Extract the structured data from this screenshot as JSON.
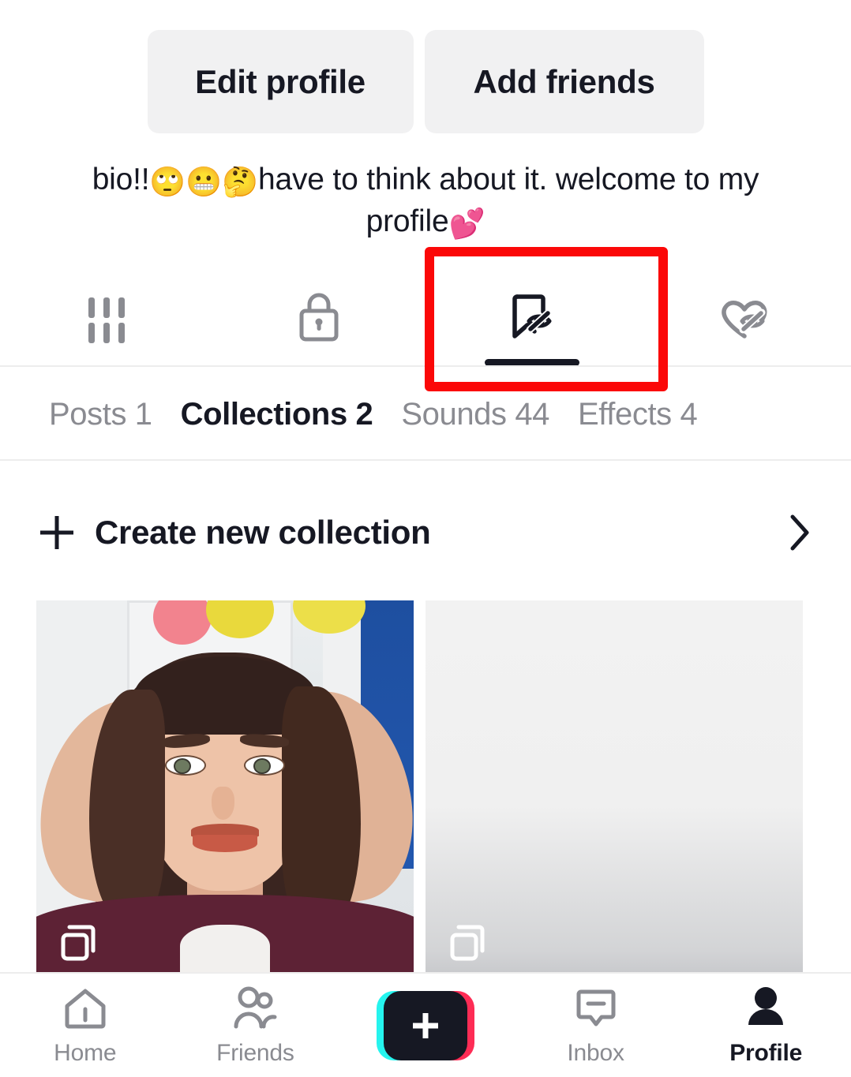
{
  "profile_actions": {
    "edit_profile_label": "Edit profile",
    "add_friends_label": "Add friends"
  },
  "bio": {
    "line1_before": "bio!!",
    "emoji1": "🙄",
    "emoji2": "😬",
    "emoji3": "🤔",
    "line1_after": "have to think about it.",
    "line2_text": "welcome to my profile",
    "emoji4": "💕",
    "full_text": "bio!!🙄😬🤔have to think about it. welcome to my profile💕"
  },
  "icon_tabs": [
    {
      "name": "posts-grid",
      "icon": "grid-bars-icon",
      "active": false
    },
    {
      "name": "private-posts",
      "icon": "lock-icon",
      "active": false
    },
    {
      "name": "saved-collections",
      "icon": "bookmark-eye-slash-icon",
      "active": true
    },
    {
      "name": "liked-videos",
      "icon": "heart-eye-slash-icon",
      "active": false
    }
  ],
  "highlight": {
    "color": "#fb0808",
    "target": "saved-collections-tab"
  },
  "sub_tabs": [
    {
      "label": "Posts 1",
      "active": false
    },
    {
      "label": "Collections 2",
      "active": true
    },
    {
      "label": "Sounds 44",
      "active": false
    },
    {
      "label": "Effects 4",
      "active": false
    }
  ],
  "create_collection": {
    "label": "Create new collection",
    "plus_icon": "plus-icon",
    "chevron_icon": "chevron-right-icon"
  },
  "collections": [
    {
      "name": "collection-card-1",
      "type": "photo",
      "badge_icon": "stacked-cards-icon"
    },
    {
      "name": "collection-card-2",
      "type": "placeholder",
      "badge_icon": "stacked-cards-icon"
    }
  ],
  "bottom_nav": [
    {
      "label": "Home",
      "icon": "home-icon",
      "active": false
    },
    {
      "label": "Friends",
      "icon": "friends-icon",
      "active": false
    },
    {
      "label": "",
      "icon": "create-plus-icon",
      "active": false
    },
    {
      "label": "Inbox",
      "icon": "inbox-icon",
      "active": false
    },
    {
      "label": "Profile",
      "icon": "profile-person-icon",
      "active": true
    }
  ],
  "colors": {
    "accent_cyan": "#25F4EE",
    "accent_pink": "#FE2C55",
    "dark": "#161823",
    "muted": "#8A8B91",
    "button_bg": "#F1F1F2",
    "highlight_red": "#FB0808"
  }
}
